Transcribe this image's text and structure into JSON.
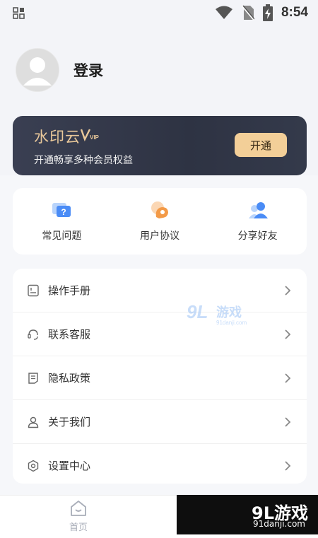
{
  "status_bar": {
    "time": "8:54"
  },
  "profile": {
    "login_label": "登录"
  },
  "vip": {
    "title": "水印云",
    "badge": "VIP",
    "subtitle": "开通畅享多种会员权益",
    "open_button": "开通"
  },
  "quick_actions": [
    {
      "label": "常见问题",
      "icon": "faq-icon"
    },
    {
      "label": "用户协议",
      "icon": "agreement-icon"
    },
    {
      "label": "分享好友",
      "icon": "share-friends-icon"
    }
  ],
  "menu": [
    {
      "label": "操作手册",
      "icon": "manual-icon"
    },
    {
      "label": "联系客服",
      "icon": "headset-icon"
    },
    {
      "label": "隐私政策",
      "icon": "document-icon"
    },
    {
      "label": "关于我们",
      "icon": "person-icon"
    },
    {
      "label": "设置中心",
      "icon": "settings-icon"
    }
  ],
  "bottom_nav": {
    "home_label": "首页"
  },
  "watermark": {
    "brand": "9L游戏",
    "domain": "91danji.com"
  },
  "colors": {
    "vip_bg": "#343a4b",
    "vip_gold": "#e9c89a",
    "open_button": "#f3cf98",
    "accent_blue": "#4a8cf6",
    "accent_orange": "#f39a47"
  }
}
